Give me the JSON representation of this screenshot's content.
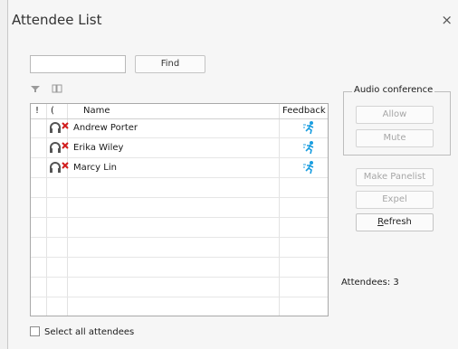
{
  "window": {
    "title": "Attendee List",
    "close_glyph": "×"
  },
  "search": {
    "value": "",
    "placeholder": "",
    "find_label": "Find"
  },
  "toolbar_icons": [
    "filter-icon",
    "columns-icon"
  ],
  "list": {
    "headers": {
      "exclaim": "!",
      "paren": "(",
      "name": "Name",
      "feedback": "Feedback"
    },
    "rows": [
      {
        "name": "Andrew Porter",
        "status_icon": "headset-muted-icon",
        "feedback_icon": "away-runner-icon"
      },
      {
        "name": "Erika Wiley",
        "status_icon": "headset-muted-icon",
        "feedback_icon": "away-runner-icon"
      },
      {
        "name": "Marcy Lin",
        "status_icon": "headset-muted-icon",
        "feedback_icon": "away-runner-icon"
      }
    ]
  },
  "audio_conference": {
    "legend": "Audio conference",
    "allow_label": "Allow",
    "mute_label": "Mute"
  },
  "actions": {
    "make_panelist_label": "Make Panelist",
    "expel_label": "Expel",
    "refresh_label_underlined": "R",
    "refresh_label_rest": "efresh"
  },
  "attendees_count_text": "Attendees: 3",
  "select_all_label": "Select all attendees",
  "colors": {
    "muted_x": "#d11a1a",
    "feedback_blue": "#1a9ee0"
  }
}
